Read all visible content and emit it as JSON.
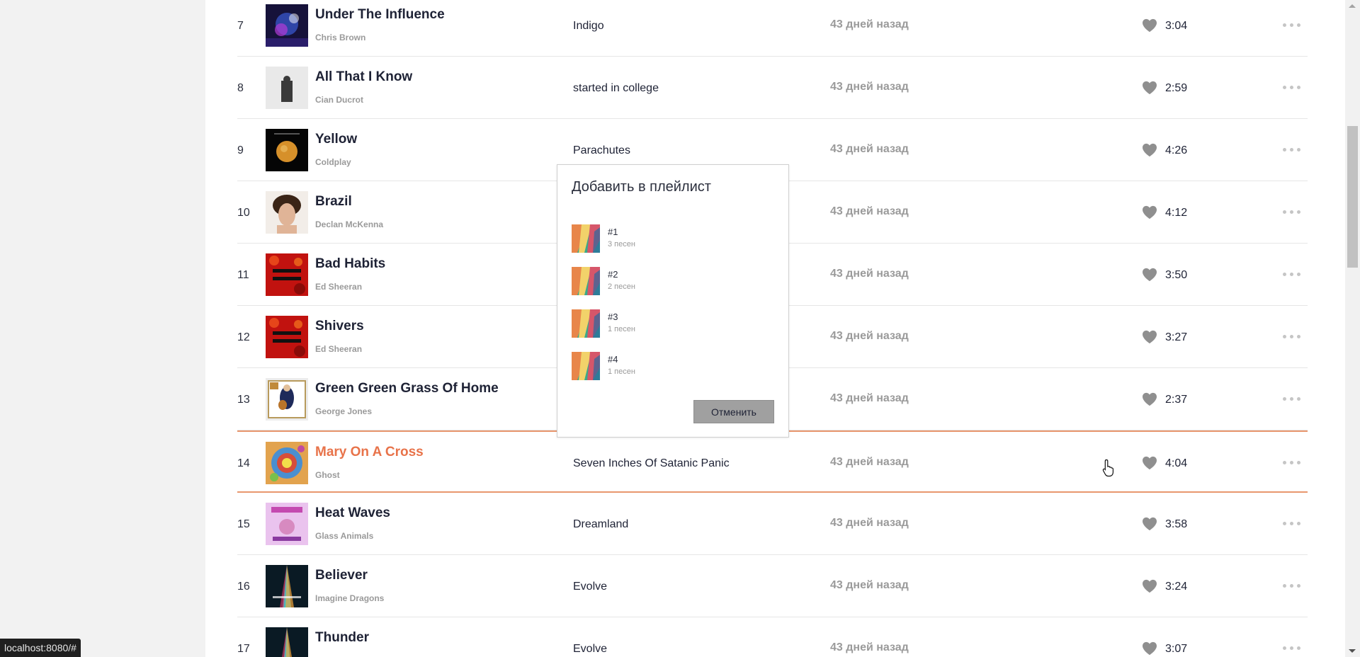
{
  "tracks": [
    {
      "num": "7",
      "title": "Under The Influence",
      "artist": "Chris Brown",
      "album": "Indigo",
      "added": "43 дней назад",
      "duration": "3:04",
      "cover": "indigo"
    },
    {
      "num": "8",
      "title": "All That I Know",
      "artist": "Cian Ducrot",
      "album": "started in college",
      "added": "43 дней назад",
      "duration": "2:59",
      "cover": "grey"
    },
    {
      "num": "9",
      "title": "Yellow",
      "artist": "Coldplay",
      "album": "Parachutes",
      "added": "43 дней назад",
      "duration": "4:26",
      "cover": "parachutes"
    },
    {
      "num": "10",
      "title": "Brazil",
      "artist": "Declan McKenna",
      "album": "",
      "added": "43 дней назад",
      "duration": "4:12",
      "cover": "portrait"
    },
    {
      "num": "11",
      "title": "Bad Habits",
      "artist": "Ed Sheeran",
      "album": "",
      "added": "43 дней назад",
      "duration": "3:50",
      "cover": "divide"
    },
    {
      "num": "12",
      "title": "Shivers",
      "artist": "Ed Sheeran",
      "album": "",
      "added": "43 дней назад",
      "duration": "3:27",
      "cover": "divide"
    },
    {
      "num": "13",
      "title": "Green Green Grass Of Home",
      "artist": "George Jones",
      "album": "",
      "added": "43 дней назад",
      "duration": "2:37",
      "cover": "guitar"
    },
    {
      "num": "14",
      "title": "Mary On A Cross",
      "artist": "Ghost",
      "album": "Seven Inches Of Satanic Panic",
      "added": "43 дней назад",
      "duration": "4:04",
      "cover": "psychedelic",
      "active": true
    },
    {
      "num": "15",
      "title": "Heat Waves",
      "artist": "Glass Animals",
      "album": "Dreamland",
      "added": "43 дней назад",
      "duration": "3:58",
      "cover": "dreamland"
    },
    {
      "num": "16",
      "title": "Believer",
      "artist": "Imagine Dragons",
      "album": "Evolve",
      "added": "43 дней назад",
      "duration": "3:24",
      "cover": "evolve"
    },
    {
      "num": "17",
      "title": "Thunder",
      "artist": "",
      "album": "Evolve",
      "added": "43 дней назад",
      "duration": "3:07",
      "cover": "evolve"
    }
  ],
  "modal": {
    "title": "Добавить в плейлист",
    "playlists": [
      {
        "name": "#1",
        "count": "3 песен"
      },
      {
        "name": "#2",
        "count": "2 песен"
      },
      {
        "name": "#3",
        "count": "1 песен"
      },
      {
        "name": "#4",
        "count": "1 песен"
      }
    ],
    "cancel_label": "Отменить"
  },
  "statusbar": {
    "url": "localhost:8080/#"
  },
  "colors": {
    "accent": "#e8734a",
    "active_border": "#e8976e",
    "muted": "#9a9a9a"
  }
}
